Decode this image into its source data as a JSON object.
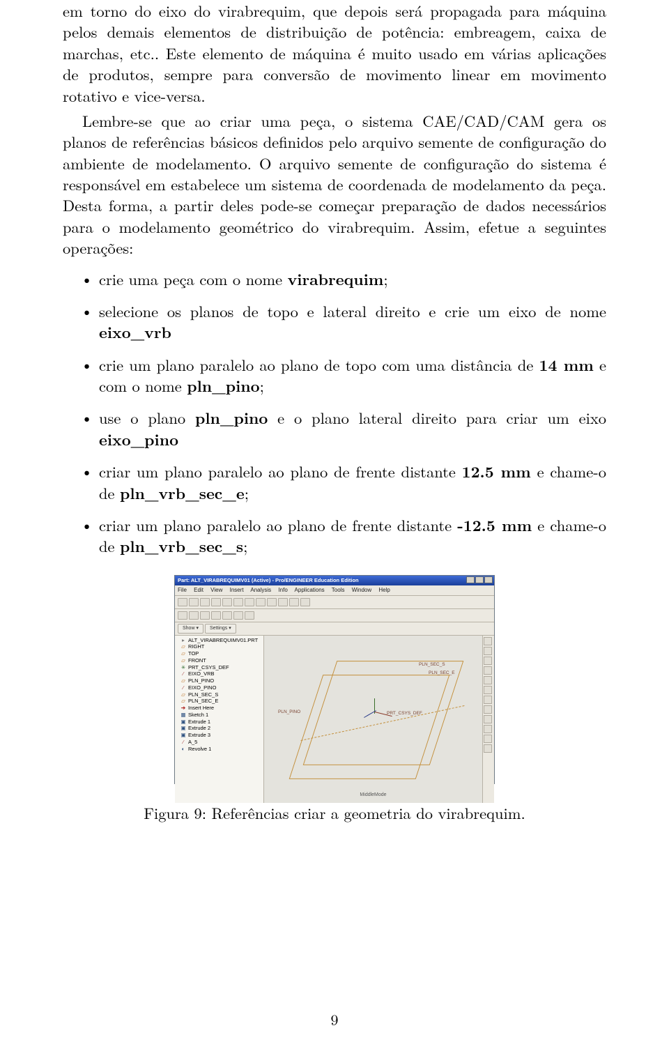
{
  "para1": "em torno do eixo do virabrequim, que depois será propagada para máquina pelos demais elementos de distribuição de potência: embreagem, caixa de marchas, etc.. Este elemento de máquina é muito usado em várias aplicações de produtos, sempre para conversão de movimento linear em movimento rotativo e vice-versa.",
  "para2_a": "Lembre-se que ao criar uma peça, o sistema CAE/CAD/CAM gera os planos de referências básicos definidos pelo arquivo semente de configuração do ambiente de modelamento. O arquivo semente de configuração do sistema é responsável em estabelece um sistema de coordenada de modelamento da peça. Desta forma, a partir deles pode-se começar preparação de dados necessários para o modelamento geométrico do virabrequim. Assim, efetue a seguintes operações:",
  "bullets": [
    {
      "pre": "crie uma peça com o nome ",
      "b1": "virabrequim",
      "post": ";"
    },
    {
      "pre": "selecione os planos de topo e lateral direito e crie um eixo de nome ",
      "b1": "eixo_vrb",
      "post": ""
    },
    {
      "pre": "crie um plano paralelo ao plano de topo com uma distância de ",
      "b1": "14 mm",
      "mid": " e com o nome ",
      "b2": "pln_pino",
      "post": ";"
    },
    {
      "pre": "use o plano ",
      "b1": "pln_pino",
      "mid": " e o plano lateral direito para criar um eixo ",
      "b2": "eixo_pino",
      "post": ""
    },
    {
      "pre": "criar um plano paralelo ao plano de frente distante ",
      "b1": "12.5 mm",
      "mid": " e chame-o de ",
      "b2": "pln_vrb_sec_e",
      "post": ";"
    },
    {
      "pre": "criar um plano paralelo ao plano de frente distante ",
      "b1": "-12.5 mm",
      "mid": " e chame-o de ",
      "b2": "pln_vrb_sec_s",
      "post": ";"
    }
  ],
  "fig": {
    "title": "Part: ALT_VIRABREQUIMV01 (Active) - Pro/ENGINEER Education Edition",
    "menu": [
      "File",
      "Edit",
      "View",
      "Insert",
      "Analysis",
      "Info",
      "Applications",
      "Tools",
      "Window",
      "Help"
    ],
    "pills": [
      "Show ▾",
      "Settings ▾"
    ],
    "tree": [
      {
        "cls": "",
        "glyph": "▸",
        "label": "ALT_VIRABREQUIMV01.PRT"
      },
      {
        "cls": "pl",
        "glyph": "▱",
        "label": "RIGHT"
      },
      {
        "cls": "pl",
        "glyph": "▱",
        "label": "TOP"
      },
      {
        "cls": "pl",
        "glyph": "▱",
        "label": "FRONT"
      },
      {
        "cls": "cs",
        "glyph": "✳",
        "label": "PRT_CSYS_DEF"
      },
      {
        "cls": "ax",
        "glyph": "⁄",
        "label": "EIXO_VRB"
      },
      {
        "cls": "pl",
        "glyph": "▱",
        "label": "PLN_PINO"
      },
      {
        "cls": "ax",
        "glyph": "⁄",
        "label": "EIXO_PINO"
      },
      {
        "cls": "pl",
        "glyph": "▱",
        "label": "PLN_SEC_S"
      },
      {
        "cls": "pl",
        "glyph": "▱",
        "label": "PLN_SEC_E"
      },
      {
        "cls": "ins",
        "glyph": "➔",
        "label": "Insert Here"
      },
      {
        "cls": "ft",
        "glyph": "▦",
        "label": "Sketch 1"
      },
      {
        "cls": "ft",
        "glyph": "▣",
        "label": "Extrude 1"
      },
      {
        "cls": "ft",
        "glyph": "▣",
        "label": "Extrude 2"
      },
      {
        "cls": "ft",
        "glyph": "▣",
        "label": "Extrude 3"
      },
      {
        "cls": "ax",
        "glyph": "⁄",
        "label": "A_5"
      },
      {
        "cls": "ft",
        "glyph": "◐",
        "label": "Revolve 1"
      }
    ],
    "labels": {
      "pln_pino": "PLN_PINO",
      "csys": "PRT_CSYS_DEF",
      "sec_s": "PLN_SEC_S",
      "sec_e": "PLN_SEC_E"
    },
    "status": "MiddleMode"
  },
  "caption": "Figura 9: Referências criar a geometria do virabrequim.",
  "pagenum": "9"
}
